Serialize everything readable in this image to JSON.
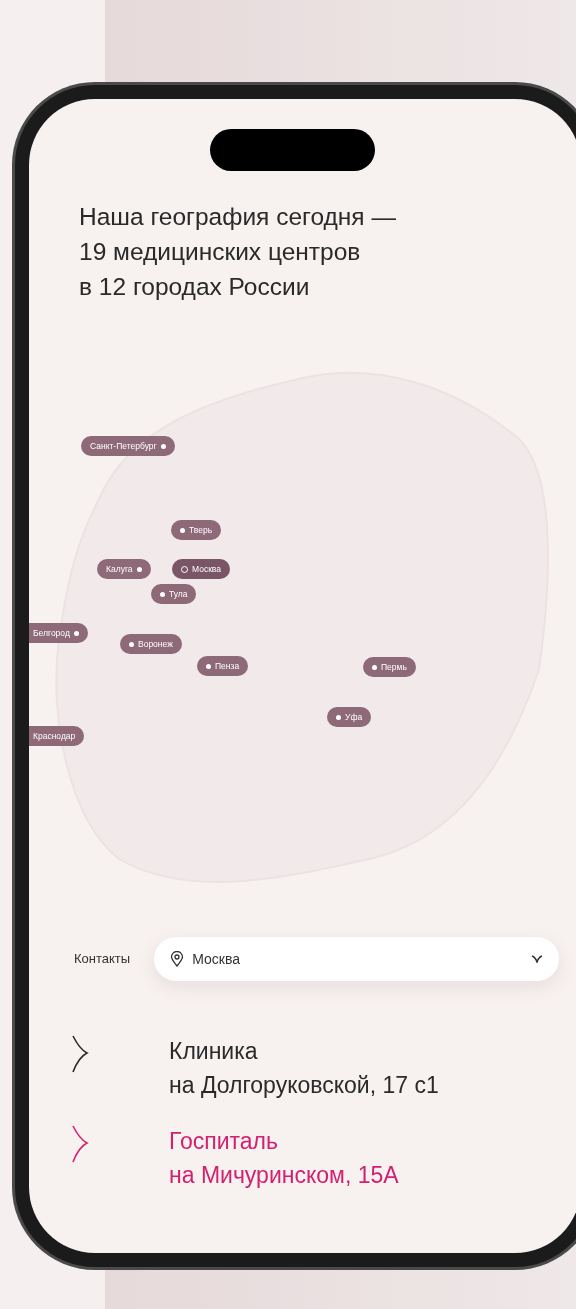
{
  "title": "Наша география сегодня —\n19 медицинских центров\nв 12 городах России",
  "map_pins": [
    {
      "label": "Санкт-Петербург",
      "kind": "dotright",
      "selected": false
    },
    {
      "label": "Тверь",
      "kind": "dotleft",
      "selected": false
    },
    {
      "label": "Калуга",
      "kind": "dotright",
      "selected": false
    },
    {
      "label": "Москва",
      "kind": "dotleft",
      "selected": true
    },
    {
      "label": "Тула",
      "kind": "dotleft",
      "selected": false
    },
    {
      "label": "Белгород",
      "kind": "dotright",
      "selected": false
    },
    {
      "label": "Воронеж",
      "kind": "dotleft",
      "selected": false
    },
    {
      "label": "Пенза",
      "kind": "dotleft",
      "selected": false
    },
    {
      "label": "Пермь",
      "kind": "dotleft",
      "selected": false
    },
    {
      "label": "Уфа",
      "kind": "dotleft",
      "selected": false
    },
    {
      "label": "Краснодар",
      "kind": "plain",
      "selected": false
    }
  ],
  "contacts": {
    "label": "Контакты",
    "city": "Москва"
  },
  "clinics": [
    {
      "name": "Клиника",
      "address": "на Долгоруковской, 17 с1",
      "selected": false
    },
    {
      "name": "Госпиталь",
      "address": "на Мичуринском, 15А",
      "selected": true
    }
  ]
}
